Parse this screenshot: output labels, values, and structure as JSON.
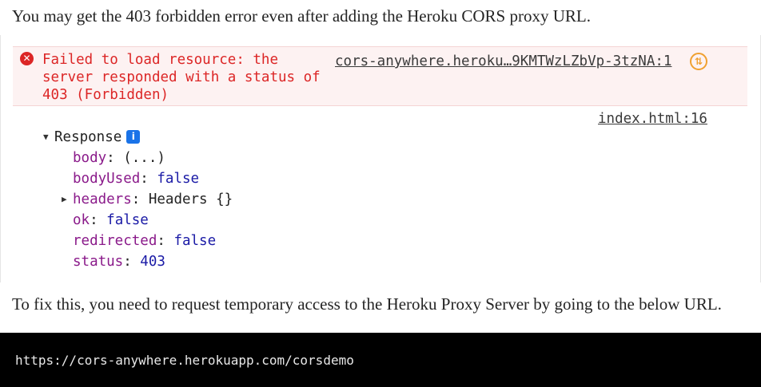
{
  "article": {
    "intro_text": "You may get the 403 forbidden error even after adding the Heroku CORS proxy URL.",
    "outro_text": "To fix this, you need to request temporary access to the Heroku Proxy Server by going to the below URL."
  },
  "console": {
    "error": {
      "icon": "error-circle-icon",
      "message": "Failed to load resource: the\nserver responded with a status of\n403 (Forbidden)",
      "source_link": "cors-anywhere.heroku…9KMTWzLZbVp-3tzNA:1",
      "network_icon": "network-request-icon"
    },
    "log_source": "index.html:16",
    "response": {
      "label": "Response",
      "info_badge": "i",
      "properties": [
        {
          "key": "body",
          "value": "(...)",
          "kind": "plain"
        },
        {
          "key": "bodyUsed",
          "value": "false",
          "kind": "bool"
        },
        {
          "key": "headers",
          "value": "Headers {}",
          "kind": "plain"
        },
        {
          "key": "ok",
          "value": "false",
          "kind": "bool"
        },
        {
          "key": "redirected",
          "value": "false",
          "kind": "bool"
        },
        {
          "key": "status",
          "value": "403",
          "kind": "num"
        }
      ]
    }
  },
  "code": {
    "url": "https://cors-anywhere.herokuapp.com/corsdemo"
  },
  "colors": {
    "error_red": "#dc2626",
    "error_bg": "#fdf2f2",
    "key_purple": "#8a1a8a",
    "value_blue": "#1a1aa6",
    "info_blue": "#1a73e8",
    "network_orange": "#f0a030"
  }
}
